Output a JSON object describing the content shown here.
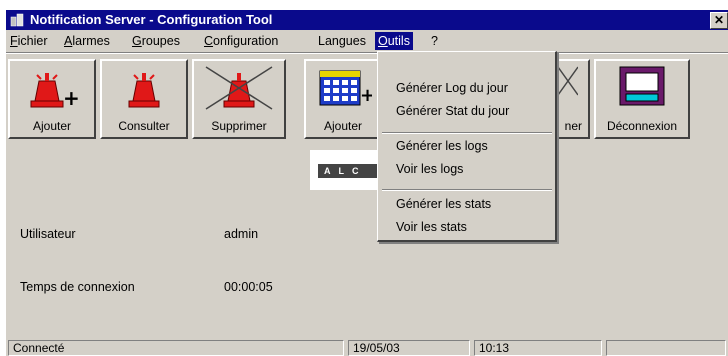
{
  "window": {
    "title": "Notification Server - Configuration Tool",
    "close_glyph": "✕"
  },
  "menubar": {
    "items": [
      {
        "label": "Fichier",
        "mnemonic": "F"
      },
      {
        "label": "Alarmes",
        "mnemonic": "A"
      },
      {
        "label": "Groupes",
        "mnemonic": "G"
      },
      {
        "label": "Configuration",
        "mnemonic": "C"
      },
      {
        "label": "Langues",
        "mnemonic": ""
      },
      {
        "label": "Outils",
        "mnemonic": "O",
        "active": true
      },
      {
        "label": "?",
        "mnemonic": ""
      }
    ]
  },
  "toolbar": {
    "buttons": [
      {
        "label": "Ajouter",
        "icon": "alarm-add-icon"
      },
      {
        "label": "Consulter",
        "icon": "alarm-view-icon"
      },
      {
        "label": "Supprimer",
        "icon": "alarm-delete-icon"
      },
      {
        "label": "Ajouter",
        "icon": "group-add-icon"
      },
      {
        "label": "ner",
        "icon": "group-delete-icon"
      },
      {
        "label": "Déconnexion",
        "icon": "disconnect-icon"
      }
    ]
  },
  "logo": {
    "text": "ALC"
  },
  "info": {
    "user_label": "Utilisateur",
    "user_value": "admin",
    "time_label": "Temps de connexion",
    "time_value": "00:00:05"
  },
  "statusbar": {
    "status": "Connecté",
    "date": "19/05/03",
    "time": "10:13"
  },
  "outils_menu": {
    "groups": [
      [
        "Générer Log du jour",
        "Générer Stat du jour"
      ],
      [
        "Générer les logs",
        "Voir les logs"
      ],
      [
        "Générer les stats",
        "Voir les stats"
      ]
    ]
  },
  "colors": {
    "titlebar": "#0a0a8c",
    "face": "#d4d0c8",
    "alarm_red": "#e01818"
  }
}
